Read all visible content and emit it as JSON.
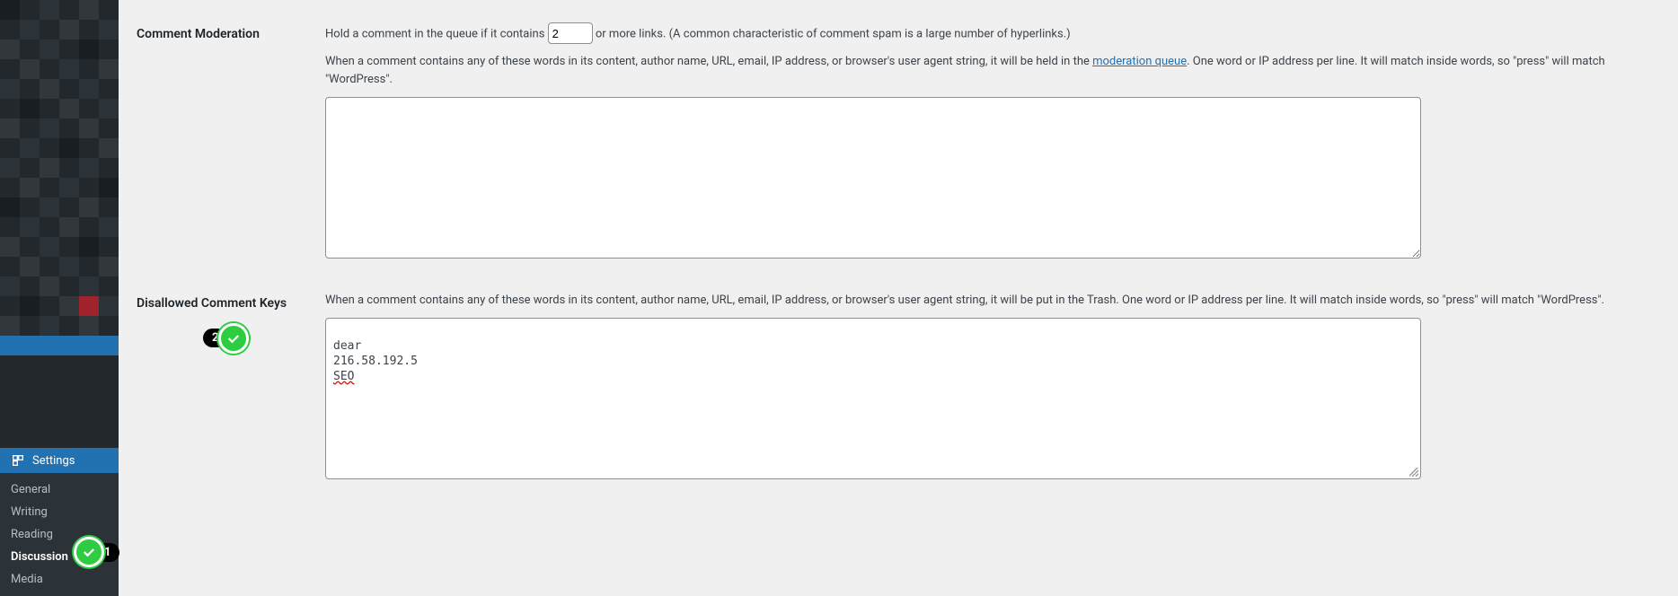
{
  "sidebar": {
    "settings_label": "Settings",
    "submenu": [
      {
        "label": "General"
      },
      {
        "label": "Writing"
      },
      {
        "label": "Reading"
      },
      {
        "label": "Discussion",
        "current": true
      },
      {
        "label": "Media"
      }
    ]
  },
  "moderation": {
    "heading": "Comment Moderation",
    "hold_before": "Hold a comment in the queue if it contains ",
    "links_value": "2",
    "hold_after": " or more links. (A common characteristic of comment spam is a large number of hyperlinks.)",
    "desc_before_link": "When a comment contains any of these words in its content, author name, URL, email, IP address, or browser's user agent string, it will be held in the ",
    "mod_queue_link": "moderation queue",
    "desc_after_link": ". One word or IP address per line. It will match inside words, so \"press\" will match \"WordPress\"."
  },
  "disallowed": {
    "heading": "Disallowed Comment Keys",
    "desc": "When a comment contains any of these words in its content, author name, URL, email, IP address, or browser's user agent string, it will be put in the Trash. One word or IP address per line. It will match inside words, so \"press\" will match \"WordPress\".",
    "line1": "dear",
    "line2": "216.58.192.5",
    "line3": "SEO"
  },
  "annotations": {
    "a1": "1",
    "a2": "2"
  }
}
